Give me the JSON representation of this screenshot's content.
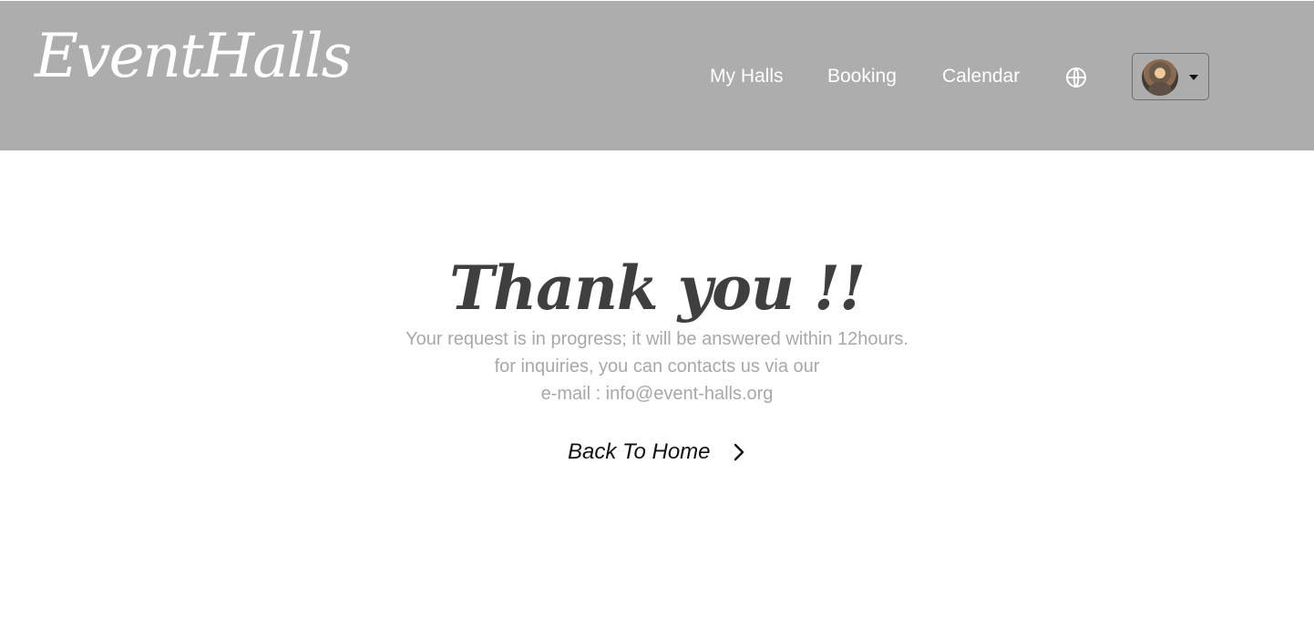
{
  "header": {
    "logo": "EventHalls",
    "nav": [
      {
        "label": "My Halls"
      },
      {
        "label": "Booking"
      },
      {
        "label": "Calendar"
      }
    ],
    "language_icon": "globe-icon",
    "user_menu_icon": "chevron-down-icon"
  },
  "main": {
    "title": "Thank you !!",
    "messages": [
      "Your request is in progress; it will be answered within 12hours.",
      "for inquiries, you can contacts us via our",
      "e-mail : info@event-halls.org"
    ],
    "back_link": {
      "label": "Back To Home",
      "icon": "chevron-right-icon"
    }
  },
  "colors": {
    "header_bg": "#acadac",
    "header_text": "#ffffff",
    "title_text": "#3f3f3f",
    "message_text": "#a8a8a8",
    "link_text": "#111111"
  }
}
